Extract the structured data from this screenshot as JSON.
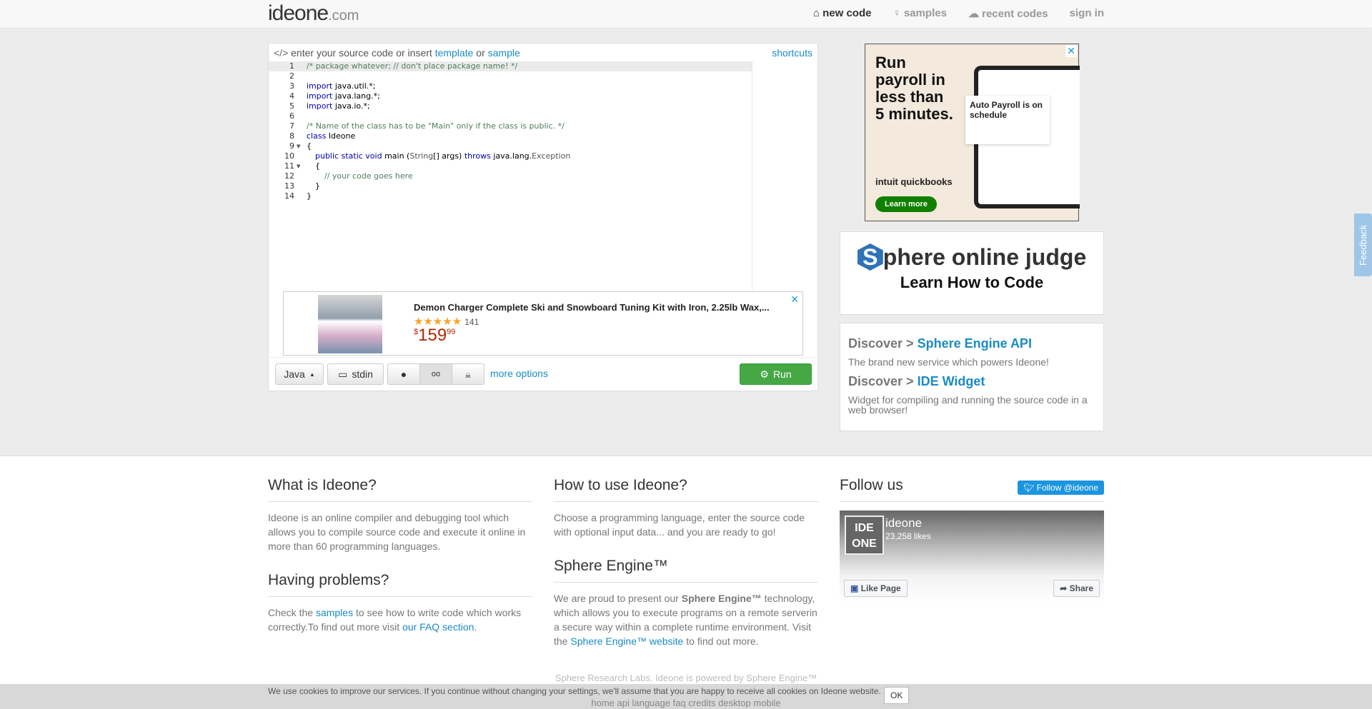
{
  "nav": {
    "logo_main": "ideone",
    "logo_suffix": ".com",
    "items": [
      {
        "label": "new code",
        "icon": "home-icon"
      },
      {
        "label": "samples",
        "icon": "lightbulb-icon"
      },
      {
        "label": "recent codes",
        "icon": "cloud-icon"
      },
      {
        "label": "sign in"
      }
    ]
  },
  "editor": {
    "prompt": "enter your source code or insert",
    "template": "template",
    "or": "or",
    "sample": "sample",
    "shortcuts": "shortcuts",
    "lines": [
      "1",
      "2",
      "3",
      "4",
      "5",
      "6",
      "7",
      "8",
      "9",
      "10",
      "11",
      "12",
      "13",
      "14"
    ],
    "code": {
      "l1": "/* package whatever; // don't place package name! */",
      "import": "import",
      "l3": " java.util.*;",
      "l4": " java.lang.*;",
      "l5": " java.io.*;",
      "l7": "/* Name of the class has to be \"Main\" only if the class is public. */",
      "class": "class",
      "l8": " Ideone",
      "brace_open": "{",
      "pub": "public static void",
      "main": " main (",
      "string": "String",
      "args": "[] args) ",
      "throws": "throws",
      "jl": " java.lang.",
      "exc": "Exception",
      "inner_open": "{",
      "comment": "// your code goes here",
      "inner_close": "}",
      "brace_close": "}"
    }
  },
  "ad_product": {
    "title": "Demon Charger Complete Ski and Snowboard Tuning Kit with Iron, 2.25lb Wax,...",
    "stars": "★★★★★",
    "reviews": "141",
    "currency": "$",
    "price_main": "159",
    "price_cents": "99",
    "close": "✕"
  },
  "toolbar": {
    "language": "Java",
    "stdin": "stdin",
    "more_options": "more options",
    "run": "Run"
  },
  "ad_quickbooks": {
    "headline": "Run payroll in less than 5 minutes.",
    "card": "Auto Payroll is on schedule",
    "brand": "intuit quickbooks",
    "cta": "Learn more",
    "close": "✕"
  },
  "spoj": {
    "s": "S",
    "title": "phere online judge",
    "subtitle": "Learn How to Code"
  },
  "discover": {
    "prefix": "Discover >",
    "api": "Sphere Engine API",
    "api_desc": "The brand new service which powers Ideone!",
    "widget": "IDE Widget",
    "widget_desc": "Widget for compiling and running the source code in a web browser!"
  },
  "info": {
    "what_title": "What is Ideone?",
    "what_text": "Ideone is an online compiler and debugging tool which allows you to compile source code and execute it online in more than 60 programming languages.",
    "problems_title": "Having problems?",
    "problems_a": "Check the ",
    "problems_link1": "samples",
    "problems_b": " to see how to write code which works correctly.To find out more visit ",
    "problems_link2": "our FAQ section",
    "problems_c": ".",
    "how_title": "How to use Ideone?",
    "how_text": "Choose a programming language, enter the source code with optional input data... and you are ready to go!",
    "se_title": "Sphere Engine™",
    "se_a": "We are proud to present our ",
    "se_bold": "Sphere Engine™",
    "se_b": " technology, which allows you to execute programs on a remote serverin a secure way within a complete runtime environment. Visit the ",
    "se_link": "Sphere Engine™ website",
    "se_c": " to find out more.",
    "follow_title": "Follow us",
    "twitter": "Follow @ideone",
    "fb_name": "ideone",
    "fb_likes": "23,258 likes",
    "fb_logo": "IDE ONE",
    "fb_like": "Like Page",
    "fb_share": "Share"
  },
  "footer": {
    "line1": "Sphere Research Labs. Ideone is powered by Sphere Engine™",
    "line2": "home api language faq credits desktop mobile"
  },
  "cookie": {
    "text": "We use cookies to improve our services. If you continue without changing your settings, we'll assume that you are happy to receive all cookies on Ideone website.",
    "ok": "OK"
  },
  "feedback": "Feedback"
}
